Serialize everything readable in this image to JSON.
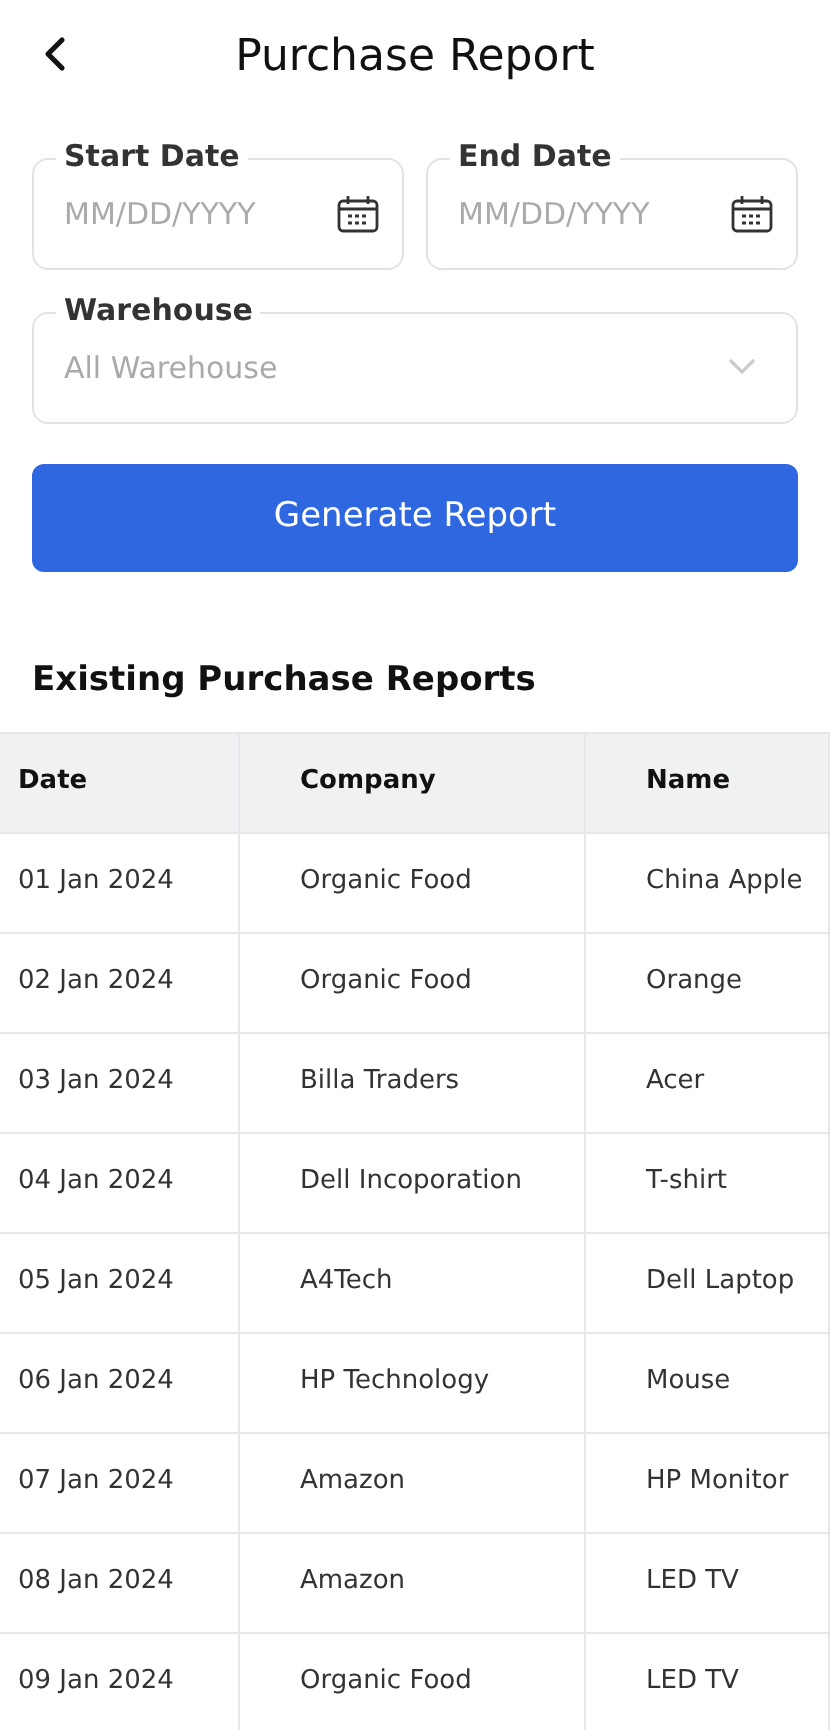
{
  "header": {
    "title": "Purchase Report"
  },
  "date_fields": [
    {
      "label": "Start Date",
      "placeholder": "MM/DD/YYYY"
    },
    {
      "label": "End Date",
      "placeholder": "MM/DD/YYYY"
    }
  ],
  "warehouse": {
    "label": "Warehouse",
    "placeholder": "All Warehouse"
  },
  "generate_button": "Generate Report",
  "section_title": "Existing Purchase Reports",
  "table": {
    "columns": [
      "Date",
      "Company",
      "Name"
    ],
    "rows": [
      [
        "01 Jan 2024",
        "Organic Food",
        "China Apple"
      ],
      [
        "02 Jan 2024",
        "Organic Food",
        "Orange"
      ],
      [
        "03 Jan 2024",
        "Billa Traders",
        "Acer"
      ],
      [
        "04 Jan 2024",
        "Dell Incoporation",
        "T-shirt"
      ],
      [
        "05 Jan 2024",
        "A4Tech",
        "Dell Laptop"
      ],
      [
        "06 Jan 2024",
        "HP Technology",
        "Mouse"
      ],
      [
        "07 Jan 2024",
        "Amazon",
        "HP Monitor"
      ],
      [
        "08 Jan 2024",
        "Amazon",
        "LED TV"
      ],
      [
        "09 Jan 2024",
        "Organic Food",
        "LED TV"
      ]
    ]
  }
}
